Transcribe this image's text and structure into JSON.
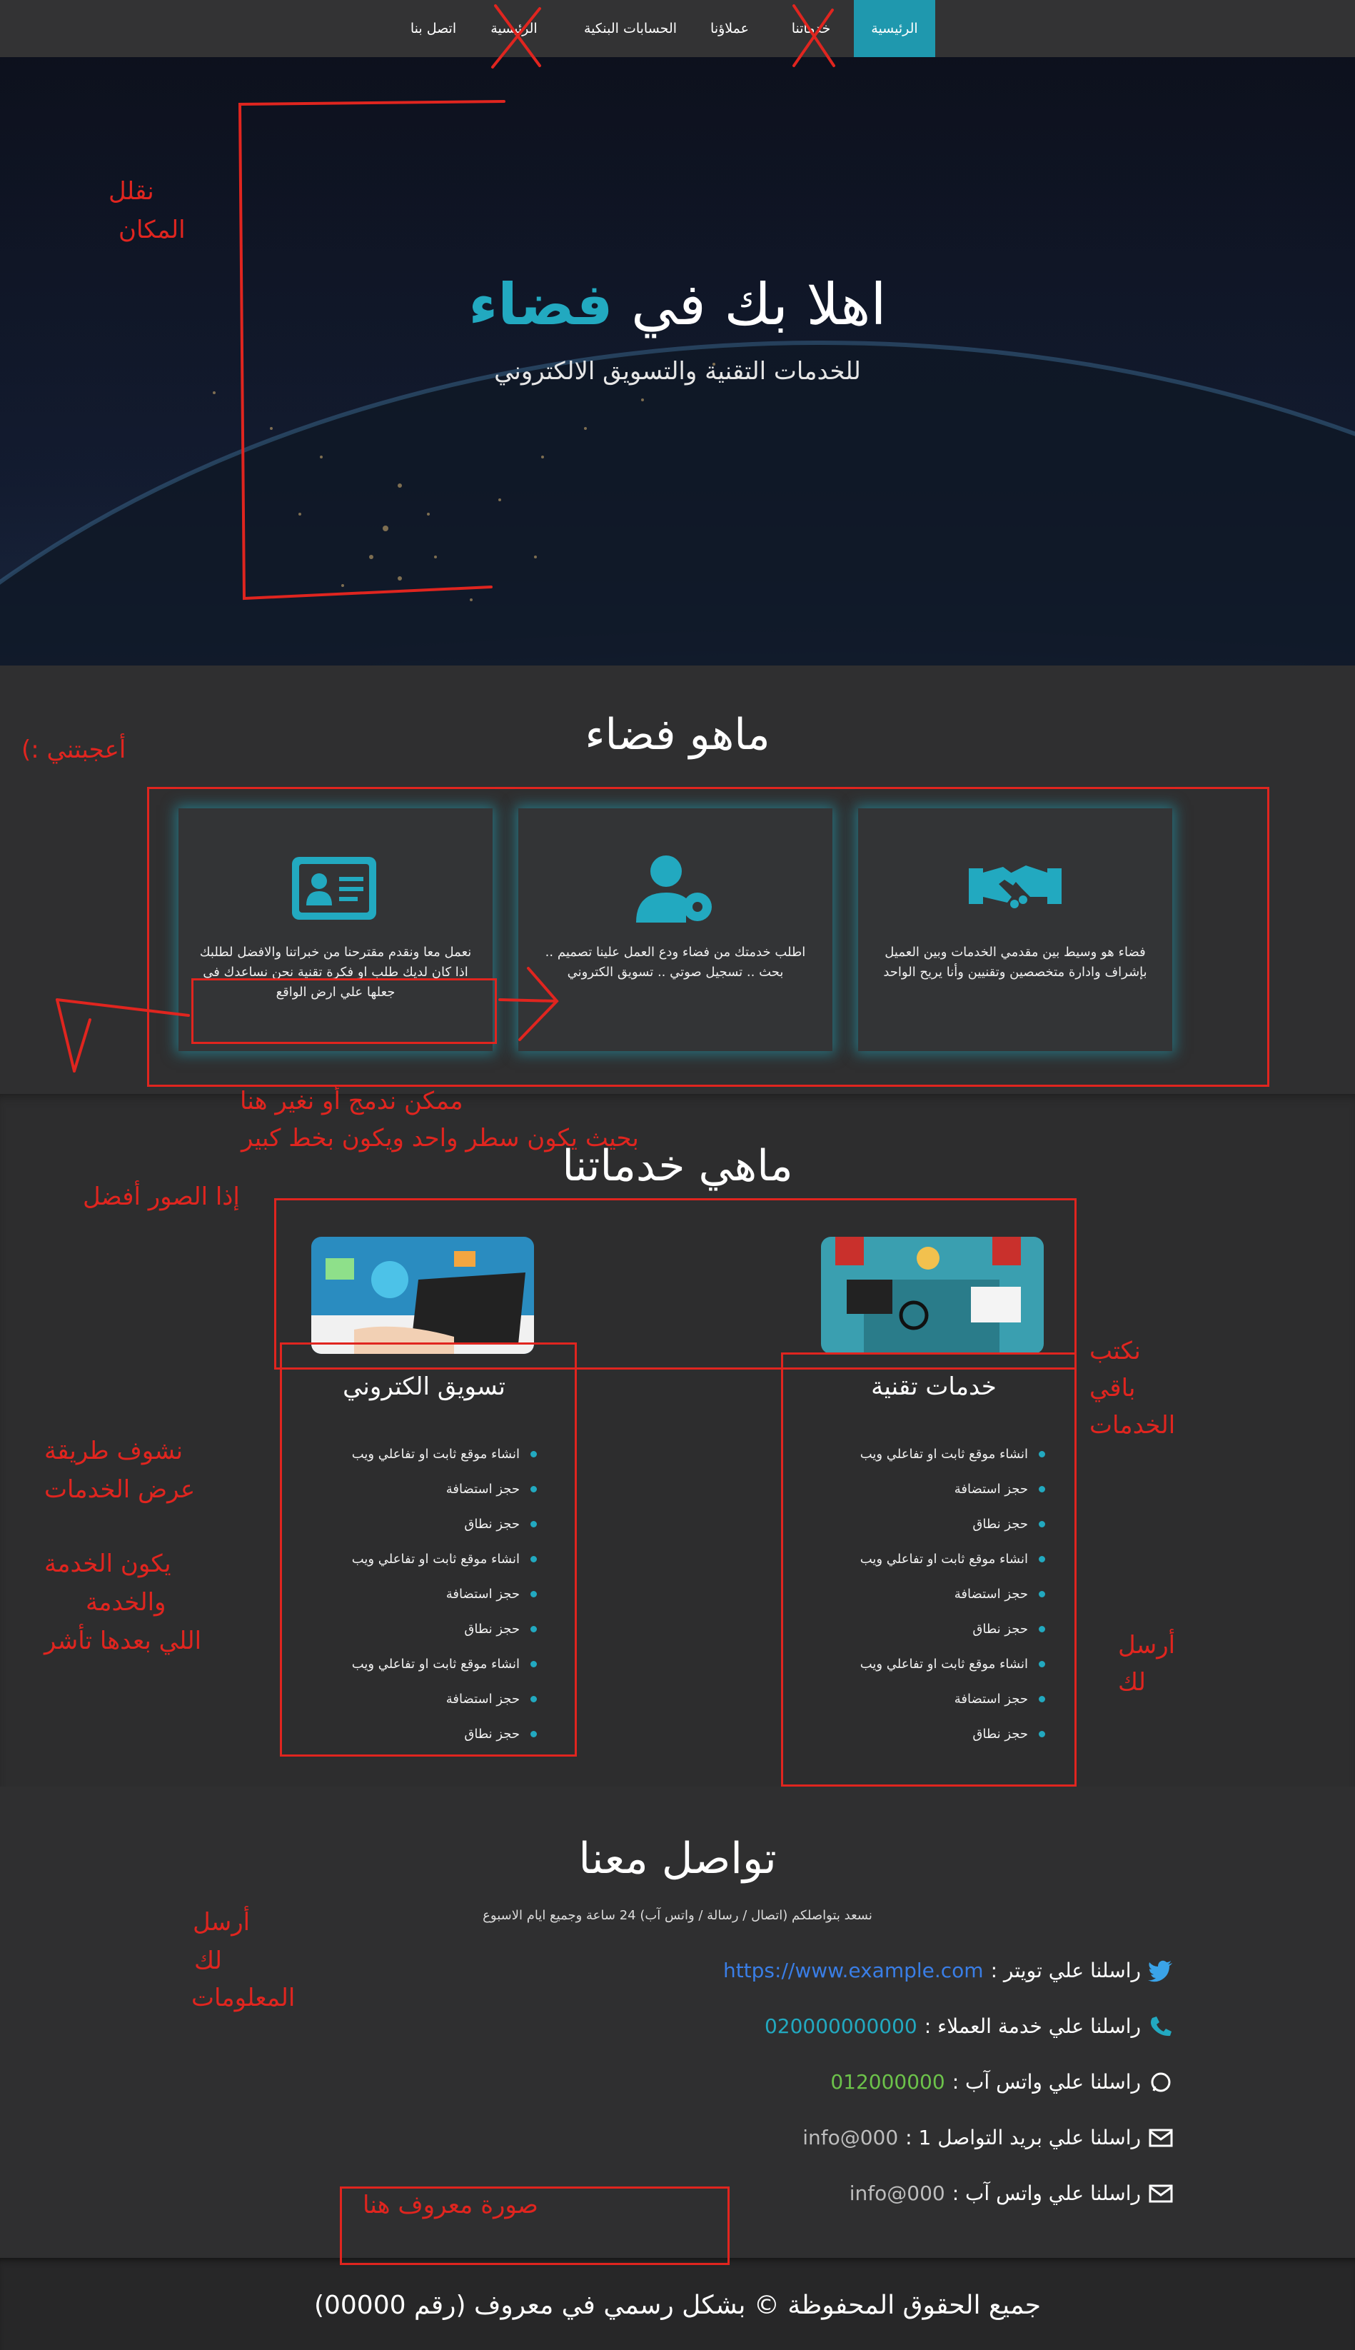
{
  "nav": {
    "items": [
      {
        "label": "الرئيسية",
        "active": true
      },
      {
        "label": "خدماتنا",
        "active": false
      },
      {
        "label": "عملاؤنا",
        "active": false
      },
      {
        "label": "الحسابات البنكية",
        "active": false
      },
      {
        "label": "الرئيسية",
        "active": false
      },
      {
        "label": "اتصل بنا",
        "active": false
      }
    ]
  },
  "hero": {
    "title_prefix": "اهلا بك في",
    "title_accent": "فضاء",
    "subtitle": "للخدمات التقنية والتسويق الالكتروني"
  },
  "about": {
    "title": "ماهو فضاء",
    "cards": [
      {
        "icon": "handshake-icon",
        "text": "فضاء هو وسيط بين مقدمي الخدمات وبين العميل بإشراف وادارة متخصصين وتقنيين وأنا يريح الواحد"
      },
      {
        "icon": "user-gear-icon",
        "text": "اطلب خدمتك من فضاء ودع العمل علينا تصميم .. بحث .. تسجيل صوتي .. تسويق الكتروني"
      },
      {
        "icon": "id-card-icon",
        "text": "نعمل معا ونقدم مقترحنا من خبراتنا والافضل لطلبك",
        "text2": "اذا كان لديك طلب او فكرة تقنية نحن نساعدك في جعلها علي ارض الواقع"
      }
    ]
  },
  "services": {
    "title": "ماهي خدماتنا",
    "columns": [
      {
        "title": "خدمات تقنية",
        "items": [
          "انشاء موقع ثابت او تفاعلي ويب",
          "حجز استضافة",
          "حجز نطاق",
          "انشاء موقع ثابت او تفاعلي ويب",
          "حجز استضافة",
          "حجز نطاق",
          "انشاء موقع ثابت او تفاعلي ويب",
          "حجز استضافة",
          "حجز نطاق"
        ]
      },
      {
        "title": "تسويق الكتروني",
        "items": [
          "انشاء موقع ثابت او تفاعلي ويب",
          "حجز استضافة",
          "حجز نطاق",
          "انشاء موقع ثابت او تفاعلي ويب",
          "حجز استضافة",
          "حجز نطاق",
          "انشاء موقع ثابت او تفاعلي ويب",
          "حجز استضافة",
          "حجز نطاق"
        ]
      }
    ]
  },
  "contact": {
    "title": "تواصل معنا",
    "description": "نسعد بتواصلكم (اتصال / رسالة / واتس آب) 24 ساعة وجميع ايام الاسبوع",
    "rows": [
      {
        "icon": "twitter-icon",
        "label": "راسلنا علي تويتر :",
        "value": "https://www.example.com",
        "color": "#3a7ee6"
      },
      {
        "icon": "phone-icon",
        "label": "راسلنا علي خدمة العملاء :",
        "value": "020000000000",
        "color": "#22a9c0"
      },
      {
        "icon": "whatsapp-icon",
        "label": "راسلنا علي واتس آب :",
        "value": "012000000",
        "color": "#6cc24a"
      },
      {
        "icon": "envelope-icon",
        "label": "راسلنا علي بريد التواصل 1 :",
        "value": "info@000",
        "color": "#bdbdbd"
      },
      {
        "icon": "envelope-icon",
        "label": "راسلنا علي واتس آب :",
        "value": "info@000",
        "color": "#bdbdbd"
      }
    ]
  },
  "footer": {
    "text": "جميع الحقوق المحفوظة © بشكل رسمي في معروف (رقم 00000)"
  },
  "annotations": {
    "move_place_1": "نقلل",
    "move_place_2": "المكان",
    "liked": "أعجبتني :)",
    "merge_1": "ممكن ندمج أو نغير هنا",
    "merge_2": "بحيث يكون سطر واحد ويكون بخط كبير",
    "images_better": "إذا الصور أفضل",
    "write_rest_1": "نكتب",
    "write_rest_2": "باقي",
    "write_rest_3": "الخدمات",
    "display_way_1": "نشوف طريقة",
    "display_way_2": "عرض الخدمات",
    "service_1": "يكون الخدمة",
    "service_2": "والخدمة",
    "service_3": "اللي بعدها تأشر",
    "send_you_1": "أرسل",
    "send_you_2": "لك",
    "send_info_1": "أرسل",
    "send_info_2": "لك",
    "send_info_3": "المعلومات",
    "known_image": "صورة معروف هنا"
  },
  "colors": {
    "accent": "#1f98ae",
    "annotation": "#e0251f"
  }
}
